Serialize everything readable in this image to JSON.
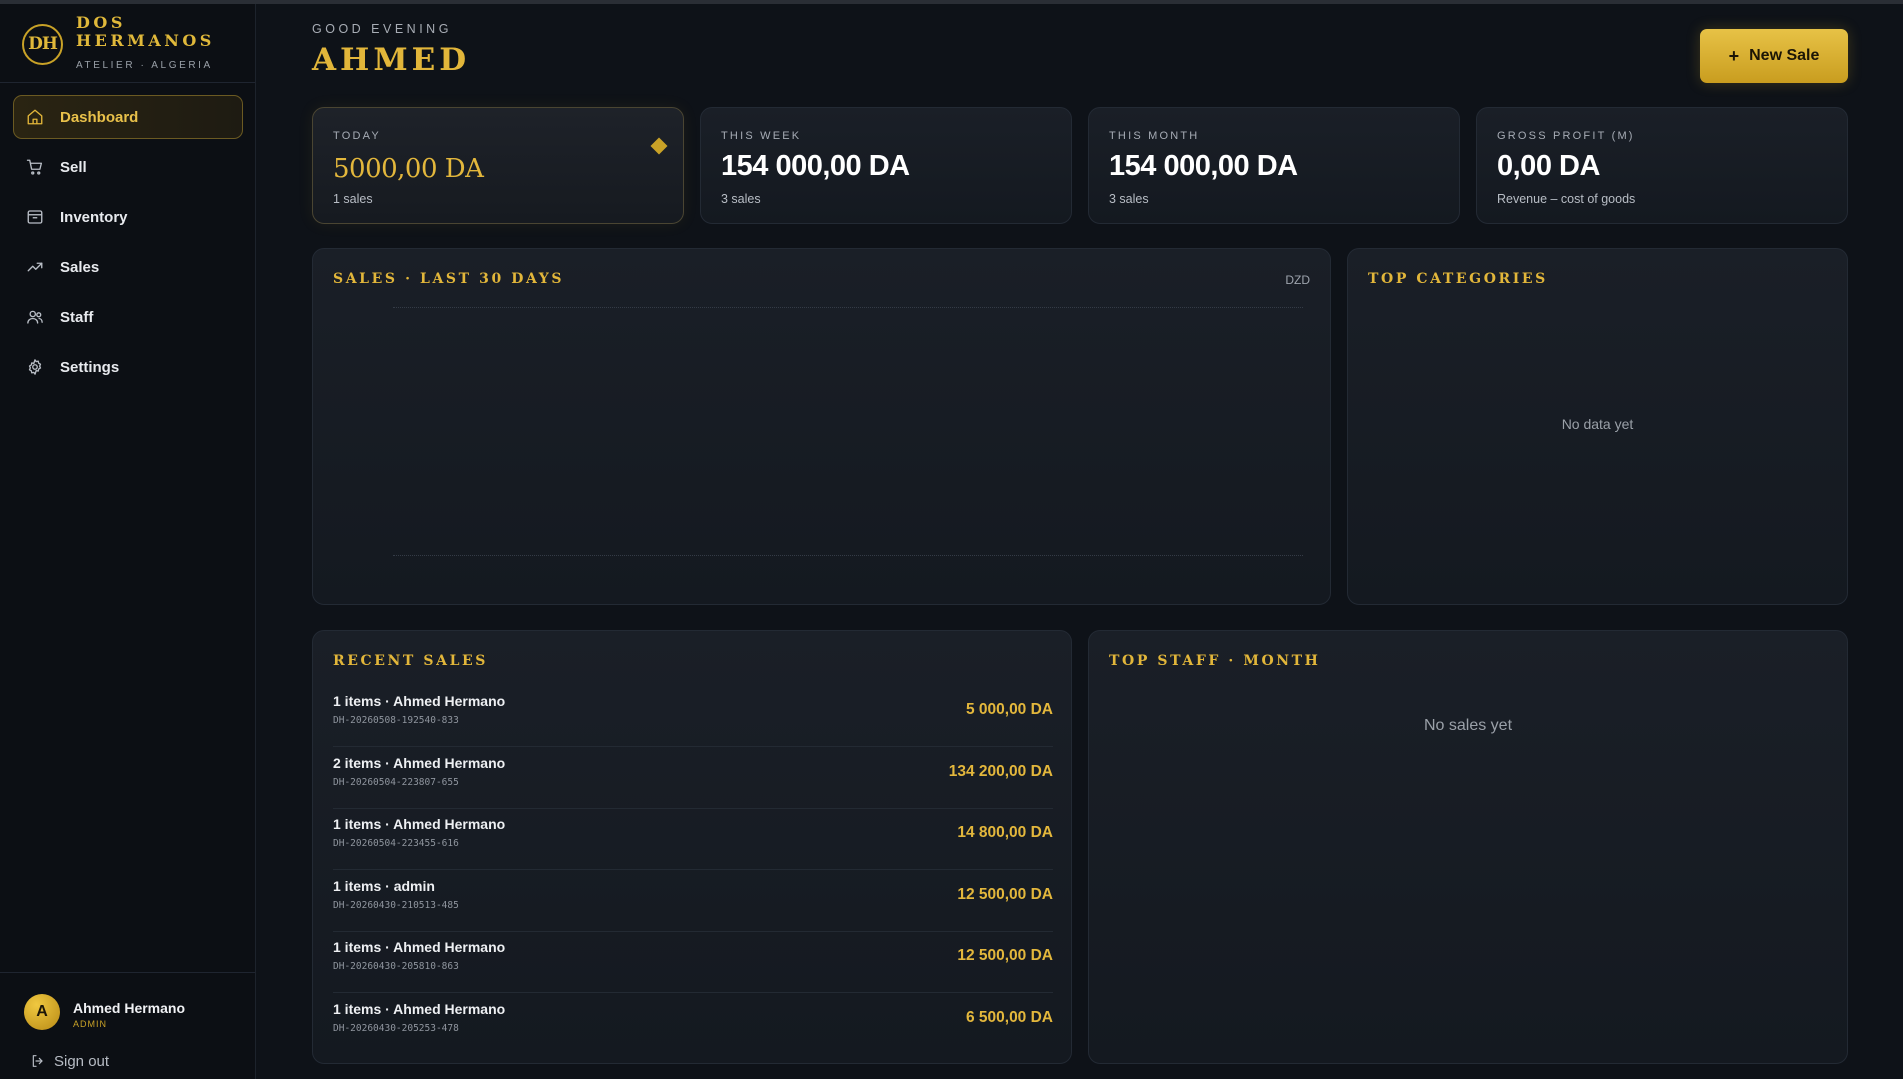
{
  "brand": {
    "initials": "DH",
    "name": "DOS HERMANOS",
    "subtitle": "ATELIER · ALGERIA"
  },
  "nav": [
    {
      "label": "Dashboard",
      "icon": "home-icon",
      "active": true
    },
    {
      "label": "Sell",
      "icon": "cart-icon"
    },
    {
      "label": "Inventory",
      "icon": "box-icon"
    },
    {
      "label": "Sales",
      "icon": "trending-up-icon"
    },
    {
      "label": "Staff",
      "icon": "users-icon"
    },
    {
      "label": "Settings",
      "icon": "gear-icon"
    }
  ],
  "user": {
    "initial": "A",
    "name": "Ahmed Hermano",
    "role": "ADMIN"
  },
  "signout": "Sign out",
  "header": {
    "greeting": "GOOD EVENING",
    "name": "AHMED",
    "new_sale": "New Sale"
  },
  "stats": [
    {
      "label": "TODAY",
      "value": "5000,00 DA",
      "sub": "1 sales"
    },
    {
      "label": "THIS WEEK",
      "value": "154 000,00 DA",
      "sub": "3 sales"
    },
    {
      "label": "THIS MONTH",
      "value": "154 000,00 DA",
      "sub": "3 sales"
    },
    {
      "label": "GROSS PROFIT (M)",
      "value": "0,00 DA",
      "sub": "Revenue – cost of goods"
    }
  ],
  "sales_chart": {
    "title": "SALES · LAST 30 DAYS",
    "unit": "DZD"
  },
  "top_categories": {
    "title": "TOP CATEGORIES",
    "empty": "No data yet"
  },
  "recent_sales": {
    "title": "RECENT SALES",
    "rows": [
      {
        "title": "1 items · Ahmed Hermano",
        "id": "DH-20260508-192540-833",
        "amount": "5 000,00 DA"
      },
      {
        "title": "2 items · Ahmed Hermano",
        "id": "DH-20260504-223807-655",
        "amount": "134 200,00 DA"
      },
      {
        "title": "1 items · Ahmed Hermano",
        "id": "DH-20260504-223455-616",
        "amount": "14 800,00 DA"
      },
      {
        "title": "1 items · admin",
        "id": "DH-20260430-210513-485",
        "amount": "12 500,00 DA"
      },
      {
        "title": "1 items · Ahmed Hermano",
        "id": "DH-20260430-205810-863",
        "amount": "12 500,00 DA"
      },
      {
        "title": "1 items · Ahmed Hermano",
        "id": "DH-20260430-205253-478",
        "amount": "6 500,00 DA"
      }
    ]
  },
  "top_staff": {
    "title": "TOP STAFF · MONTH",
    "empty": "No sales yet"
  },
  "colors": {
    "accent": "#e2b63a",
    "background": "#0e1218",
    "card": "#171c23"
  }
}
